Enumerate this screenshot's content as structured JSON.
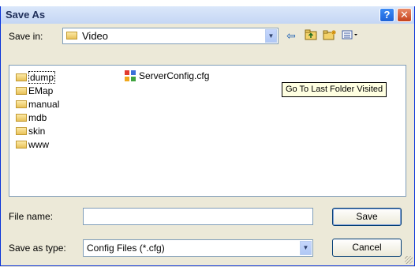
{
  "window": {
    "title": "Save As",
    "help_label": "?",
    "close_label": "✕"
  },
  "toolbar": {
    "save_in_label": "Save in:",
    "save_in_value": "Video",
    "dropdown_arrow": "▼",
    "icons": [
      "back-arrow-icon",
      "up-folder-icon",
      "new-folder-icon",
      "views-menu-icon"
    ]
  },
  "tooltip": "Go To Last Folder Visited",
  "files": {
    "folders": [
      "dump",
      "EMap",
      "manual",
      "mdb",
      "skin",
      "www"
    ],
    "file": "ServerConfig.cfg"
  },
  "form": {
    "file_name_label": "File name:",
    "file_name_value": "",
    "save_as_type_label": "Save as type:",
    "save_as_type_value": "Config Files (*.cfg)",
    "save_button": "Save",
    "cancel_button": "Cancel"
  }
}
